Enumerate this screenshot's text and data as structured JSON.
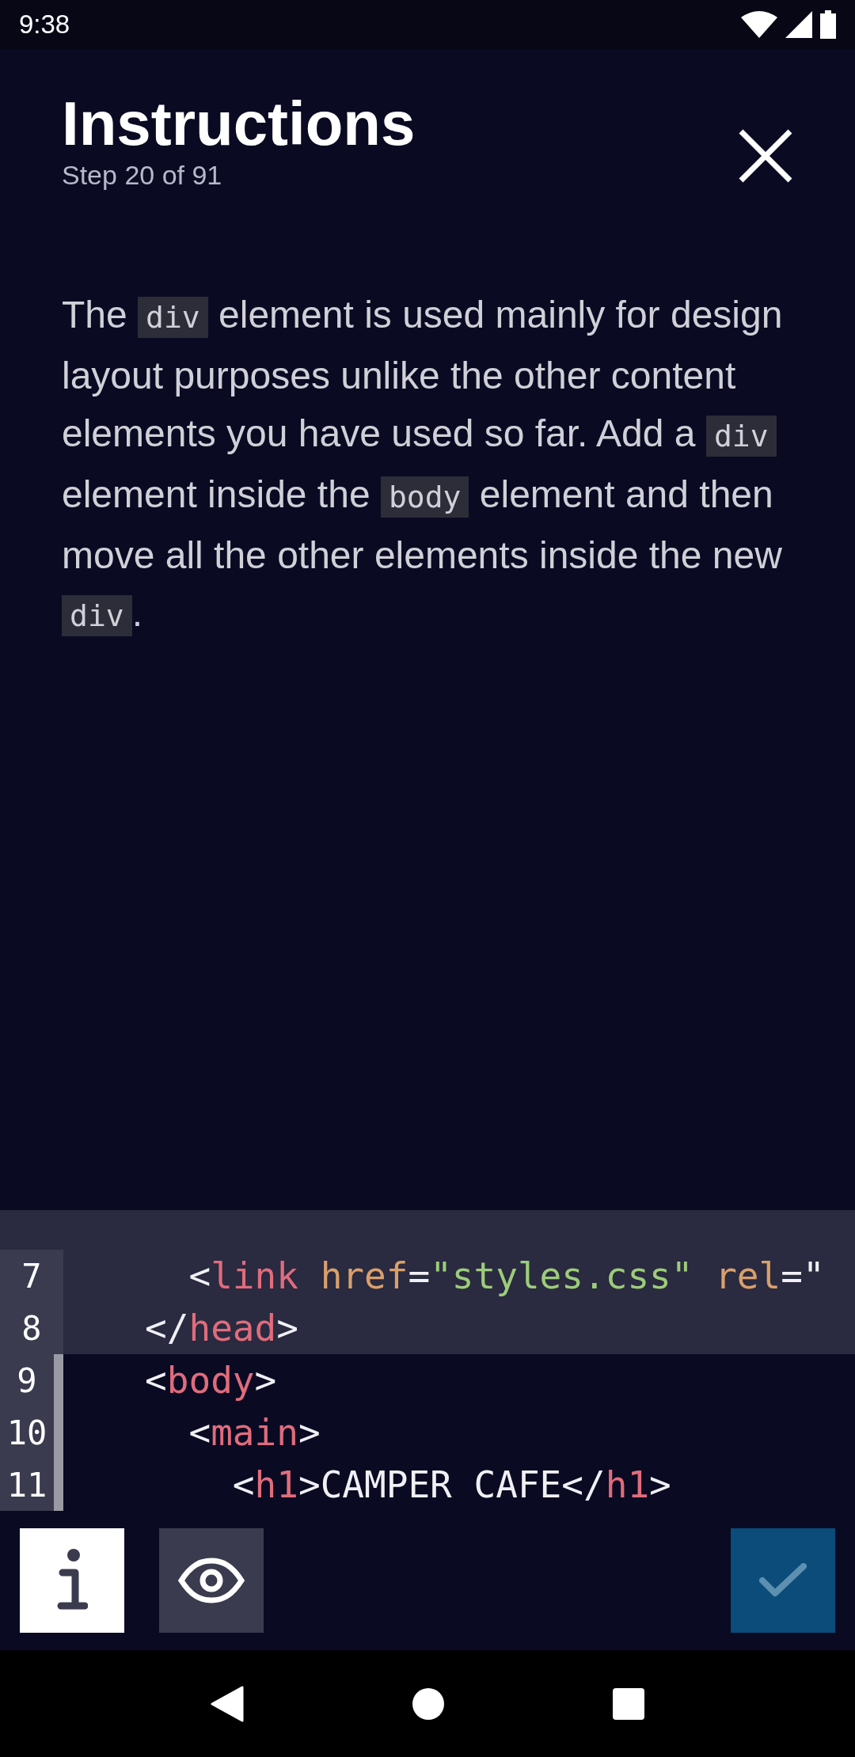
{
  "status_bar": {
    "time": "9:38"
  },
  "header": {
    "title": "Instructions",
    "subtitle": "Step 20 of 91"
  },
  "instructions": [
    {
      "kind": "text",
      "text": "The "
    },
    {
      "kind": "code",
      "text": "div"
    },
    {
      "kind": "text",
      "text": " element is used mainly for design layout purposes unlike the other content elements you have used so far. Add a "
    },
    {
      "kind": "code",
      "text": "div"
    },
    {
      "kind": "text",
      "text": " element inside the "
    },
    {
      "kind": "code",
      "text": "body"
    },
    {
      "kind": "text",
      "text": " element and then move all the other elements inside the new "
    },
    {
      "kind": "code",
      "text": "div"
    },
    {
      "kind": "text",
      "text": "."
    }
  ],
  "editor": {
    "lines": [
      {
        "number": "7",
        "highlighted": true,
        "tokens": [
          {
            "kind": "punct",
            "text": "     <"
          },
          {
            "kind": "tag",
            "text": "link"
          },
          {
            "kind": "attr",
            "text": " href"
          },
          {
            "kind": "punct",
            "text": "="
          },
          {
            "kind": "string",
            "text": "\"styles.css\""
          },
          {
            "kind": "attr",
            "text": " rel"
          },
          {
            "kind": "punct",
            "text": "=\""
          }
        ]
      },
      {
        "number": "8",
        "highlighted": true,
        "tokens": [
          {
            "kind": "punct",
            "text": "   </"
          },
          {
            "kind": "tag",
            "text": "head"
          },
          {
            "kind": "punct",
            "text": ">"
          }
        ]
      },
      {
        "number": "9",
        "highlighted": false,
        "tokens": [
          {
            "kind": "punct",
            "text": "   <"
          },
          {
            "kind": "tag",
            "text": "body"
          },
          {
            "kind": "punct",
            "text": ">"
          }
        ]
      },
      {
        "number": "10",
        "highlighted": false,
        "tokens": [
          {
            "kind": "punct",
            "text": "     <"
          },
          {
            "kind": "tag",
            "text": "main"
          },
          {
            "kind": "punct",
            "text": ">"
          }
        ]
      },
      {
        "number": "11",
        "highlighted": false,
        "tokens": [
          {
            "kind": "punct",
            "text": "       <"
          },
          {
            "kind": "tag",
            "text": "h1"
          },
          {
            "kind": "punct",
            "text": ">CAMPER CAFE</"
          },
          {
            "kind": "tag",
            "text": "h1"
          },
          {
            "kind": "punct",
            "text": ">"
          }
        ]
      }
    ]
  },
  "toolbar": {
    "buttons": [
      {
        "kind": "info",
        "selected": true
      },
      {
        "kind": "preview",
        "selected": false
      }
    ],
    "check": {
      "disabled": true
    }
  }
}
